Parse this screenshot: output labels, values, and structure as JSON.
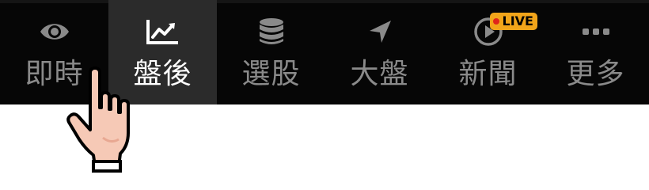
{
  "tabbar": {
    "tabs": [
      {
        "label": "即時",
        "icon": "eye-icon",
        "active": false
      },
      {
        "label": "盤後",
        "icon": "chart-line-icon",
        "active": true
      },
      {
        "label": "選股",
        "icon": "database-icon",
        "active": false
      },
      {
        "label": "大盤",
        "icon": "navigation-arrow-icon",
        "active": false
      },
      {
        "label": "新聞",
        "icon": "play-circle-icon",
        "active": false,
        "badge": "LIVE"
      },
      {
        "label": "更多",
        "icon": "more-dots-icon",
        "active": false
      }
    ]
  },
  "colors": {
    "bar_background": "#060606",
    "active_tab_background": "#2b2b2b",
    "inactive_label": "#8a8a8a",
    "active_label": "#ffffff",
    "live_badge": "#f2a51a",
    "live_dot": "#e0251b"
  },
  "cursor": {
    "icon": "pointing-hand-cursor-icon"
  }
}
